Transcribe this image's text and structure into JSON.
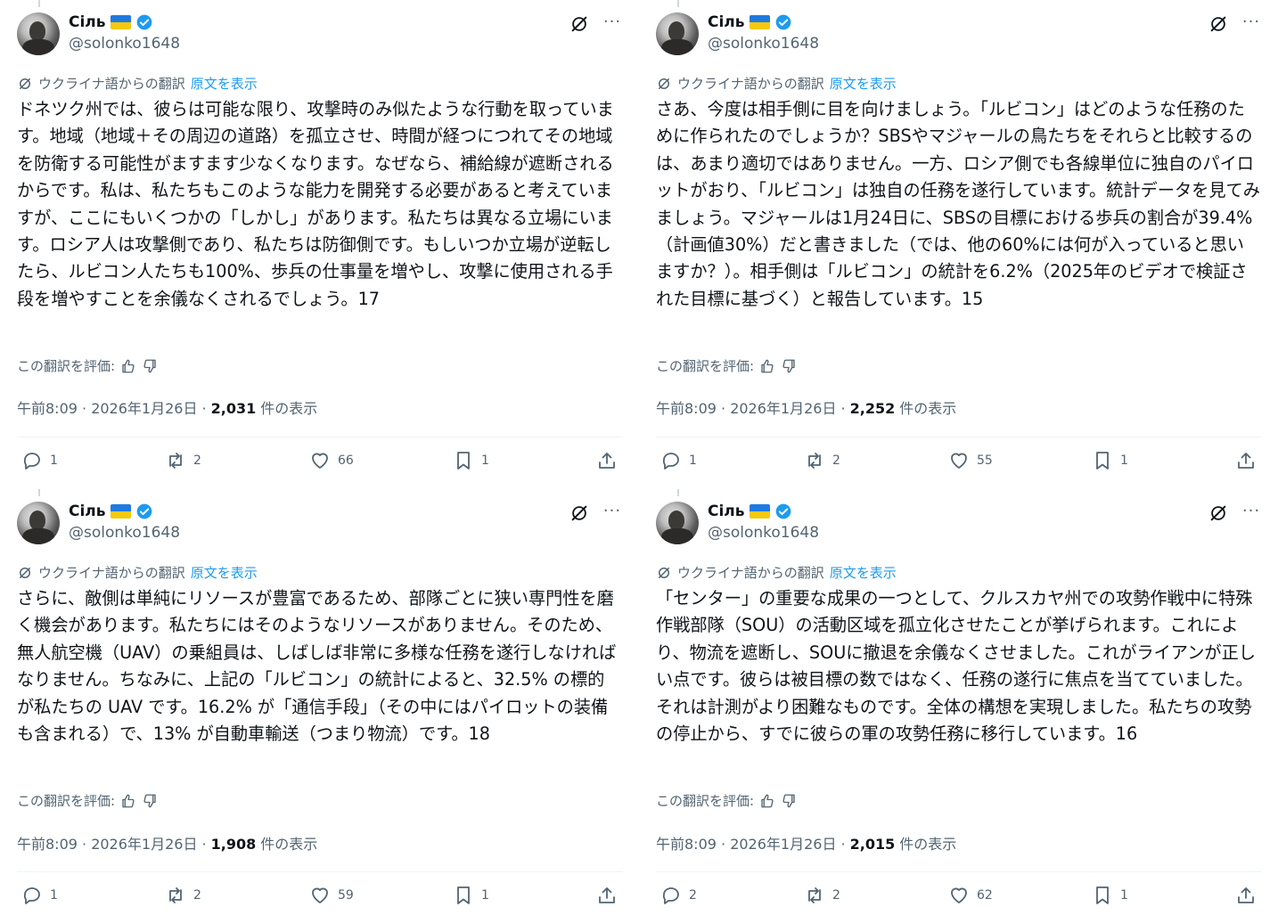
{
  "tweets": [
    {
      "name": "Сіль",
      "handle": "@solonko1648",
      "translation_label": "ウクライナ語からの翻訳",
      "show_original": "原文を表示",
      "text": "ドネツク州では、彼らは可能な限り、攻撃時のみ似たような行動を取っています。地域（地域＋その周辺の道路）を孤立させ、時間が経つにつれてその地域を防衛する可能性がますます少なくなります。なぜなら、補給線が遮断されるからです。私は、私たちもこのような能力を開発する必要があると考えていますが、ここにもいくつかの「しかし」があります。私たちは異なる立場にいます。ロシア人は攻撃側であり、私たちは防御側です。もしいつか立場が逆転したら、ルビコン人たちも100%、歩兵の仕事量を増やし、攻撃に使用される手段を増やすことを余儀なくされるでしょう。17",
      "rate_label": "この翻訳を評価:",
      "timestamp": "午前8:09 · 2026年1月26日 ·",
      "views": "2,031",
      "views_suffix": "件の表示",
      "replies": "1",
      "retweets": "2",
      "likes": "66",
      "bookmarks": "1"
    },
    {
      "name": "Сіль",
      "handle": "@solonko1648",
      "translation_label": "ウクライナ語からの翻訳",
      "show_original": "原文を表示",
      "text": "さあ、今度は相手側に目を向けましょう。「ルビコン」はどのような任務のために作られたのでしょうか？SBSやマジャールの鳥たちをそれらと比較するのは、あまり適切ではありません。一方、ロシア側でも各線単位に独自のパイロットがおり、「ルビコン」は独自の任務を遂行しています。統計データを見てみましょう。マジャールは1月24日に、SBSの目標における歩兵の割合が39.4%（計画値30%）だと書きました（では、他の60%には何が入っていると思いますか？）。相手側は「ルビコン」の統計を6.2%（2025年のビデオで検証された目標に基づく）と報告しています。15",
      "rate_label": "この翻訳を評価:",
      "timestamp": "午前8:09 · 2026年1月26日 ·",
      "views": "2,252",
      "views_suffix": "件の表示",
      "replies": "1",
      "retweets": "2",
      "likes": "55",
      "bookmarks": "1"
    },
    {
      "name": "Сіль",
      "handle": "@solonko1648",
      "translation_label": "ウクライナ語からの翻訳",
      "show_original": "原文を表示",
      "text": "さらに、敵側は単純にリソースが豊富であるため、部隊ごとに狭い専門性を磨く機会があります。私たちにはそのようなリソースがありません。そのため、無人航空機（UAV）の乗組員は、しばしば非常に多様な任務を遂行しなければなりません。ちなみに、上記の「ルビコン」の統計によると、32.5% の標的が私たちの UAV です。16.2% が「通信手段」（その中にはパイロットの装備も含まれる）で、13% が自動車輸送（つまり物流）です。18",
      "rate_label": "この翻訳を評価:",
      "timestamp": "午前8:09 · 2026年1月26日 ·",
      "views": "1,908",
      "views_suffix": "件の表示",
      "replies": "1",
      "retweets": "2",
      "likes": "59",
      "bookmarks": "1"
    },
    {
      "name": "Сіль",
      "handle": "@solonko1648",
      "translation_label": "ウクライナ語からの翻訳",
      "show_original": "原文を表示",
      "text": "「センター」の重要な成果の一つとして、クルスカヤ州での攻勢作戦中に特殊作戦部隊（SOU）の活動区域を孤立化させたことが挙げられます。これにより、物流を遮断し、SOUに撤退を余儀なくさせました。これがライアンが正しい点です。彼らは被目標の数ではなく、任務の遂行に焦点を当てていました。それは計測がより困難なものです。全体の構想を実現しました。私たちの攻勢の停止から、すでに彼らの軍の攻勢任務に移行しています。16",
      "rate_label": "この翻訳を評価:",
      "timestamp": "午前8:09 · 2026年1月26日 ·",
      "views": "2,015",
      "views_suffix": "件の表示",
      "replies": "2",
      "retweets": "2",
      "likes": "62",
      "bookmarks": "1"
    }
  ],
  "icons": [
    "grok-icon",
    "more-icon",
    "translate-icon",
    "thumbs-up-icon",
    "thumbs-down-icon",
    "reply-icon",
    "retweet-icon",
    "like-icon",
    "bookmark-icon",
    "share-icon",
    "verified-icon"
  ],
  "colors": {
    "text": "#0f1419",
    "muted": "#536471",
    "link": "#1d9bf0",
    "verified": "#1d9bf0"
  }
}
